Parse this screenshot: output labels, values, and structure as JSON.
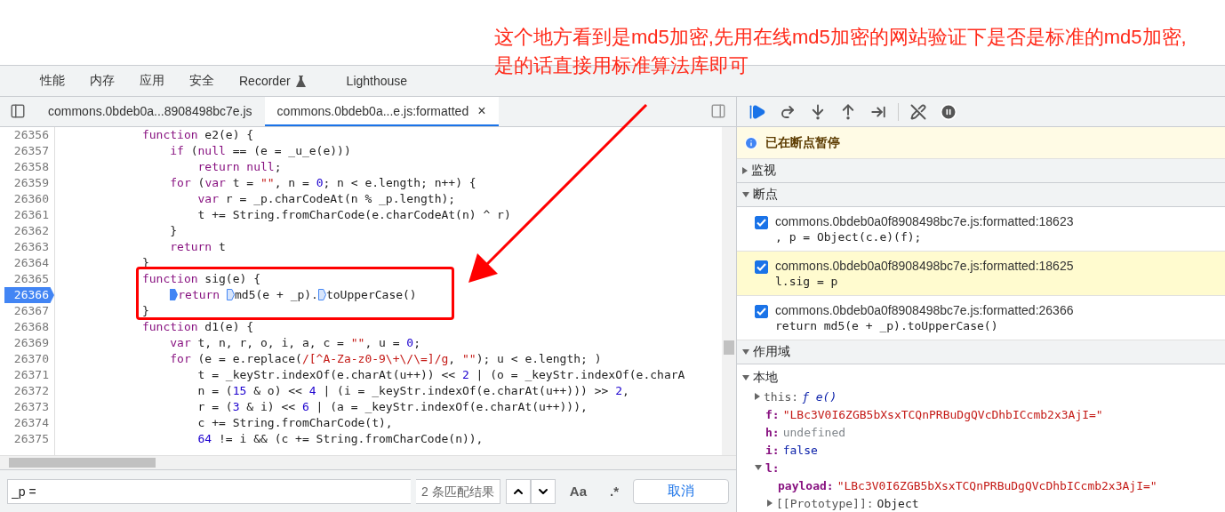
{
  "annotation": {
    "text": "这个地方看到是md5加密,先用在线md5加密的网站验证下是否是标准的md5加密,是的话直接用标准算法库即可"
  },
  "top_tabs": [
    {
      "label": "性能",
      "kind": "plain"
    },
    {
      "label": "内存",
      "kind": "plain"
    },
    {
      "label": "应用",
      "kind": "plain"
    },
    {
      "label": "安全",
      "kind": "plain"
    },
    {
      "label": "Recorder",
      "kind": "experimental"
    },
    {
      "label": "Lighthouse",
      "kind": "plain"
    }
  ],
  "file_tabs": [
    {
      "label": "commons.0bdeb0a...8908498bc7e.js",
      "selected": false,
      "closable": false
    },
    {
      "label": "commons.0bdeb0a...e.js:formatted",
      "selected": true,
      "closable": true,
      "close": "×"
    }
  ],
  "code": {
    "lines": [
      {
        "number": "26356",
        "breakpoint": false,
        "text": "            function e2(e) {"
      },
      {
        "number": "26357",
        "breakpoint": false,
        "text": "                if (null == (e = _u_e(e)))"
      },
      {
        "number": "26358",
        "breakpoint": false,
        "text": "                    return null;"
      },
      {
        "number": "26359",
        "breakpoint": false,
        "text": "                for (var t = \"\", n = 0; n < e.length; n++) {"
      },
      {
        "number": "26360",
        "breakpoint": false,
        "text": "                    var r = _p.charCodeAt(n % _p.length);"
      },
      {
        "number": "26361",
        "breakpoint": false,
        "text": "                    t += String.fromCharCode(e.charCodeAt(n) ^ r)"
      },
      {
        "number": "26362",
        "breakpoint": false,
        "text": "                }"
      },
      {
        "number": "26363",
        "breakpoint": false,
        "text": "                return t"
      },
      {
        "number": "26364",
        "breakpoint": false,
        "text": "            }"
      },
      {
        "number": "26365",
        "breakpoint": false,
        "text": "            function sig(e) {"
      },
      {
        "number": "26366",
        "breakpoint": true,
        "parts": [
          {
            "text": "                return ",
            "active": true
          },
          {
            "text": "md5(e + _p).",
            "active": false
          },
          {
            "text": "toUpperCase()",
            "active": false
          }
        ]
      },
      {
        "number": "26367",
        "breakpoint": false,
        "text": "            }"
      },
      {
        "number": "26368",
        "breakpoint": false,
        "text": "            function d1(e) {"
      },
      {
        "number": "26369",
        "breakpoint": false,
        "text": "                var t, n, r, o, i, a, c = \"\", u = 0;"
      },
      {
        "number": "26370",
        "breakpoint": false,
        "text": "                for (e = e.replace(/[^A-Za-z0-9\\+\\/\\=]/g, \"\"); u < e.length; )"
      },
      {
        "number": "26371",
        "breakpoint": false,
        "text": "                    t = _keyStr.indexOf(e.charAt(u++)) << 2 | (o = _keyStr.indexOf(e.charA"
      },
      {
        "number": "26372",
        "breakpoint": false,
        "text": "                    n = (15 & o) << 4 | (i = _keyStr.indexOf(e.charAt(u++))) >> 2,"
      },
      {
        "number": "26373",
        "breakpoint": false,
        "text": "                    r = (3 & i) << 6 | (a = _keyStr.indexOf(e.charAt(u++))),"
      },
      {
        "number": "26374",
        "breakpoint": false,
        "text": "                    c += String.fromCharCode(t),"
      },
      {
        "number": "26375",
        "breakpoint": false,
        "text": "                    64 != i && (c += String.fromCharCode(n)),"
      }
    ]
  },
  "search": {
    "value": "_p =",
    "matches": "2 条匹配结果",
    "case_button": "Aa",
    "regex_button": ".*",
    "cancel": "取消"
  },
  "paused_banner": {
    "text": "已在断点暂停"
  },
  "watch": {
    "title": "监视",
    "expanded": false
  },
  "breakpoints": {
    "title": "断点",
    "expanded": true,
    "items": [
      {
        "location": "commons.0bdeb0a0f8908498bc7e.js:formatted:18623",
        "code": ", p = Object(c.e)(f);",
        "checked": true,
        "selected": false
      },
      {
        "location": "commons.0bdeb0a0f8908498bc7e.js:formatted:18625",
        "code": "l.sig = p",
        "checked": true,
        "selected": true
      },
      {
        "location": "commons.0bdeb0a0f8908498bc7e.js:formatted:26366",
        "code": "return md5(e + _p).toUpperCase()",
        "checked": true,
        "selected": false
      }
    ]
  },
  "scope": {
    "title": "作用域",
    "expanded": true,
    "groups": [
      {
        "label": "本地",
        "expanded": true,
        "children": [
          {
            "name": "this:",
            "dimmed": true,
            "value": "ƒ e()",
            "kind": "function",
            "expanded": false
          },
          {
            "name": "f:",
            "dimmed": false,
            "value": "\"LBc3V0I6ZGB5bXsxTCQnPRBuDgQVcDhbICcmb2x3AjI=\"",
            "kind": "string"
          },
          {
            "name": "h:",
            "dimmed": false,
            "value": "undefined",
            "kind": "undefined"
          },
          {
            "name": "i:",
            "dimmed": false,
            "value": "false",
            "kind": "boolean"
          },
          {
            "name": "l:",
            "dimmed": false,
            "kind": "object",
            "expanded": true,
            "children": [
              {
                "name": "payload:",
                "dimmed": false,
                "value": "\"LBc3V0I6ZGB5bXsxTCQnPRBuDgQVcDhbICcmb2x3AjI=\"",
                "kind": "string"
              },
              {
                "name": "[[Prototype]]:",
                "dimmed": true,
                "value": "Object",
                "kind": "plain",
                "expanded": false
              }
            ]
          }
        ]
      }
    ]
  }
}
